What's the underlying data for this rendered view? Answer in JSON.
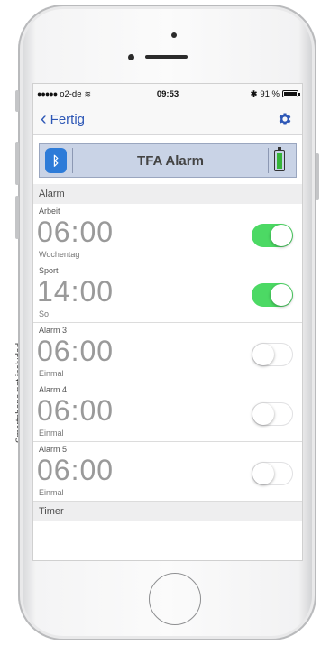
{
  "side_note": "Smartphone not included",
  "status_bar": {
    "carrier": "o2-de",
    "time": "09:53",
    "battery": "91 %"
  },
  "nav": {
    "back_label": "Fertig",
    "settings_icon": "gear-icon"
  },
  "device": {
    "title": "TFA Alarm",
    "bluetooth_icon": "bluetooth-icon",
    "battery_icon": "battery-icon",
    "battery_color": "#36b43a"
  },
  "alarm_section": {
    "header": "Alarm",
    "items": [
      {
        "name": "Arbeit",
        "time": "06:00",
        "repeat": "Wochentag",
        "enabled": true
      },
      {
        "name": "Sport",
        "time": "14:00",
        "repeat": "So",
        "enabled": true
      },
      {
        "name": "Alarm 3",
        "time": "06:00",
        "repeat": "Einmal",
        "enabled": false
      },
      {
        "name": "Alarm 4",
        "time": "06:00",
        "repeat": "Einmal",
        "enabled": false
      },
      {
        "name": "Alarm 5",
        "time": "06:00",
        "repeat": "Einmal",
        "enabled": false
      }
    ]
  },
  "timer_section": {
    "header": "Timer"
  },
  "colors": {
    "accent": "#2d57b6",
    "toggle_on": "#4cd964"
  }
}
